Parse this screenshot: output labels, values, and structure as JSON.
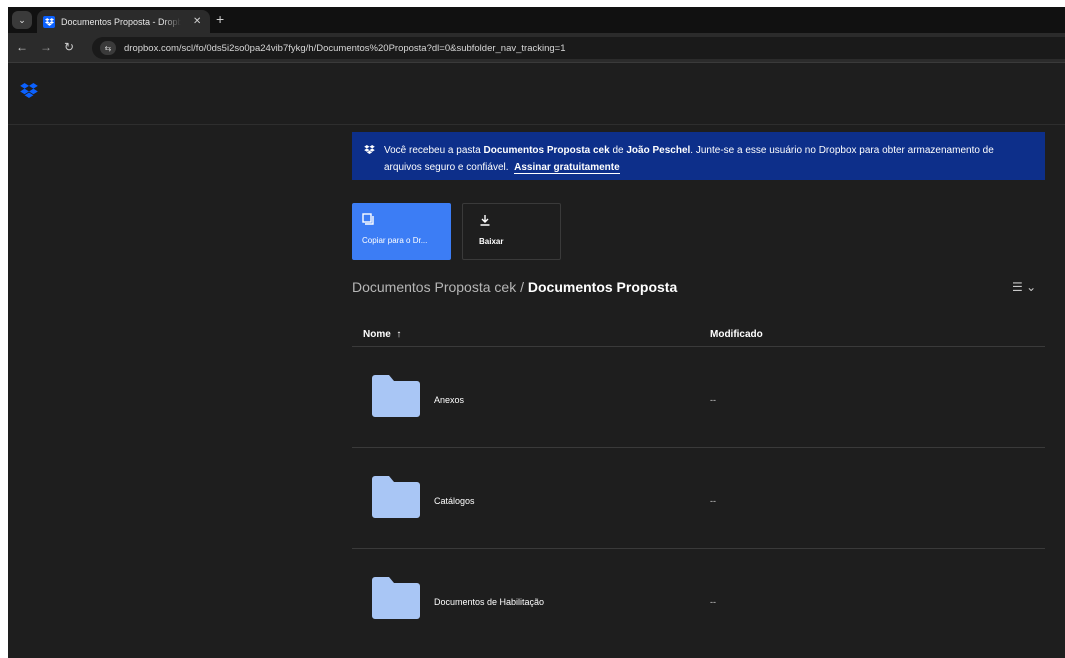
{
  "browser": {
    "tab_title": "Documentos Proposta - Dropbox",
    "new_tab_icon": "plus-icon",
    "url": "dropbox.com/scl/fo/0ds5i2so0pa24vib7fykg/h/Documentos%20Proposta?dl=0&subfolder_nav_tracking=1"
  },
  "banner": {
    "text_1": "Você recebeu a pasta ",
    "folder_name": "Documentos Proposta cek",
    "text_2": " de ",
    "owner": "João Peschel",
    "text_3": ". Junte-se a esse usuário no Dropbox para obter armazenamento de arquivos seguro e confiável.",
    "cta": "Assinar gratuitamente",
    "background_color": "#0d2f8a"
  },
  "actions": {
    "copy_label": "Copiar para o Dr...",
    "download_label": "Baixar",
    "copy_color": "#3c7df5"
  },
  "breadcrumb": {
    "parent": "Documentos Proposta cek",
    "separator": "/",
    "current": "Documentos Proposta"
  },
  "table": {
    "col_name": "Nome",
    "sort_indicator": "↑",
    "col_modified": "Modificado",
    "rows": [
      {
        "name": "Anexos",
        "modified": "--"
      },
      {
        "name": "Catálogos",
        "modified": "--"
      },
      {
        "name": "Documentos de Habilitação",
        "modified": "--"
      }
    ]
  }
}
